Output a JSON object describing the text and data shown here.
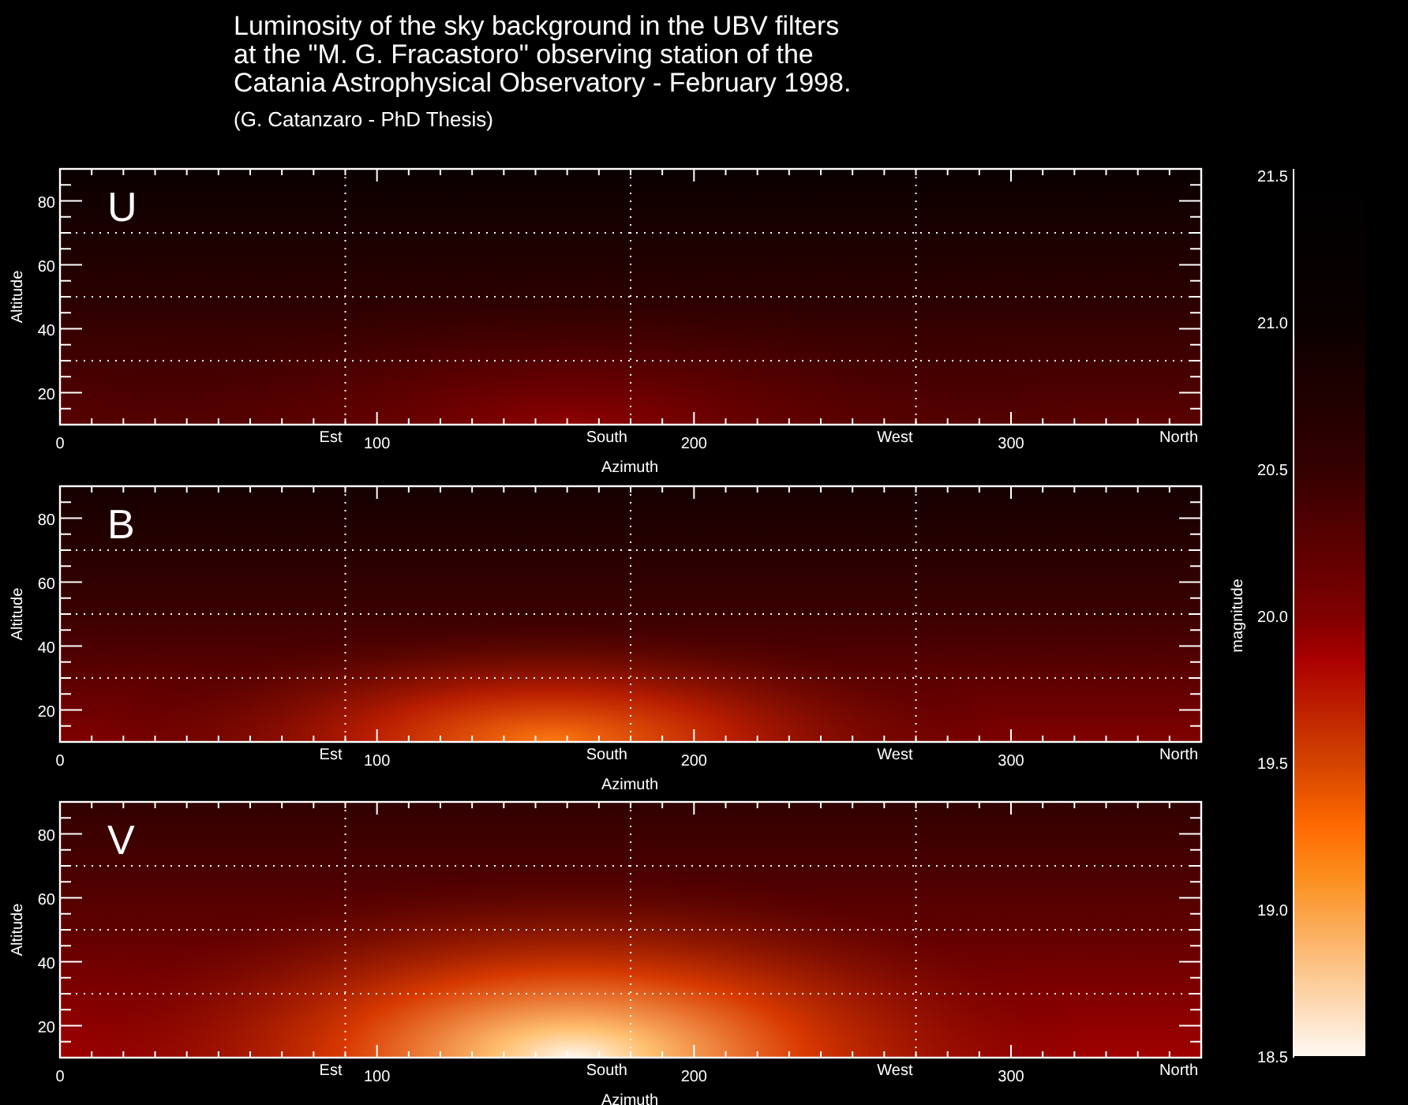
{
  "title": {
    "lines": [
      "Luminosity of the sky background in the UBV filters",
      "at the \"M. G. Fracastoro\" observing station of the",
      "Catania Astrophysical Observatory - February 1998."
    ],
    "subtitle": "(G. Catanzaro - PhD Thesis)"
  },
  "panels": [
    {
      "label": "U",
      "ylabel": "Altitude",
      "xlabel": "Azimuth",
      "yticks": [
        "80",
        "60",
        "40",
        "20"
      ],
      "xticks": [
        "0",
        "100",
        "200",
        "300"
      ],
      "directions": [
        "Est",
        "South",
        "West",
        "North"
      ]
    },
    {
      "label": "B",
      "ylabel": "Altitude",
      "xlabel": "Azimuth",
      "yticks": [
        "80",
        "60",
        "40",
        "20"
      ],
      "xticks": [
        "0",
        "100",
        "200",
        "300"
      ],
      "directions": [
        "Est",
        "South",
        "West",
        "North"
      ]
    },
    {
      "label": "V",
      "ylabel": "Altitude",
      "xlabel": "Azimuth",
      "yticks": [
        "80",
        "60",
        "40",
        "20"
      ],
      "xticks": [
        "0",
        "100",
        "200",
        "300"
      ],
      "directions": [
        "Est",
        "South",
        "West",
        "North"
      ]
    }
  ],
  "colorbar": {
    "label": "magnitude",
    "ticks": [
      "21.5",
      "21.0",
      "20.5",
      "20.0",
      "19.5",
      "19.0",
      "18.5"
    ]
  }
}
